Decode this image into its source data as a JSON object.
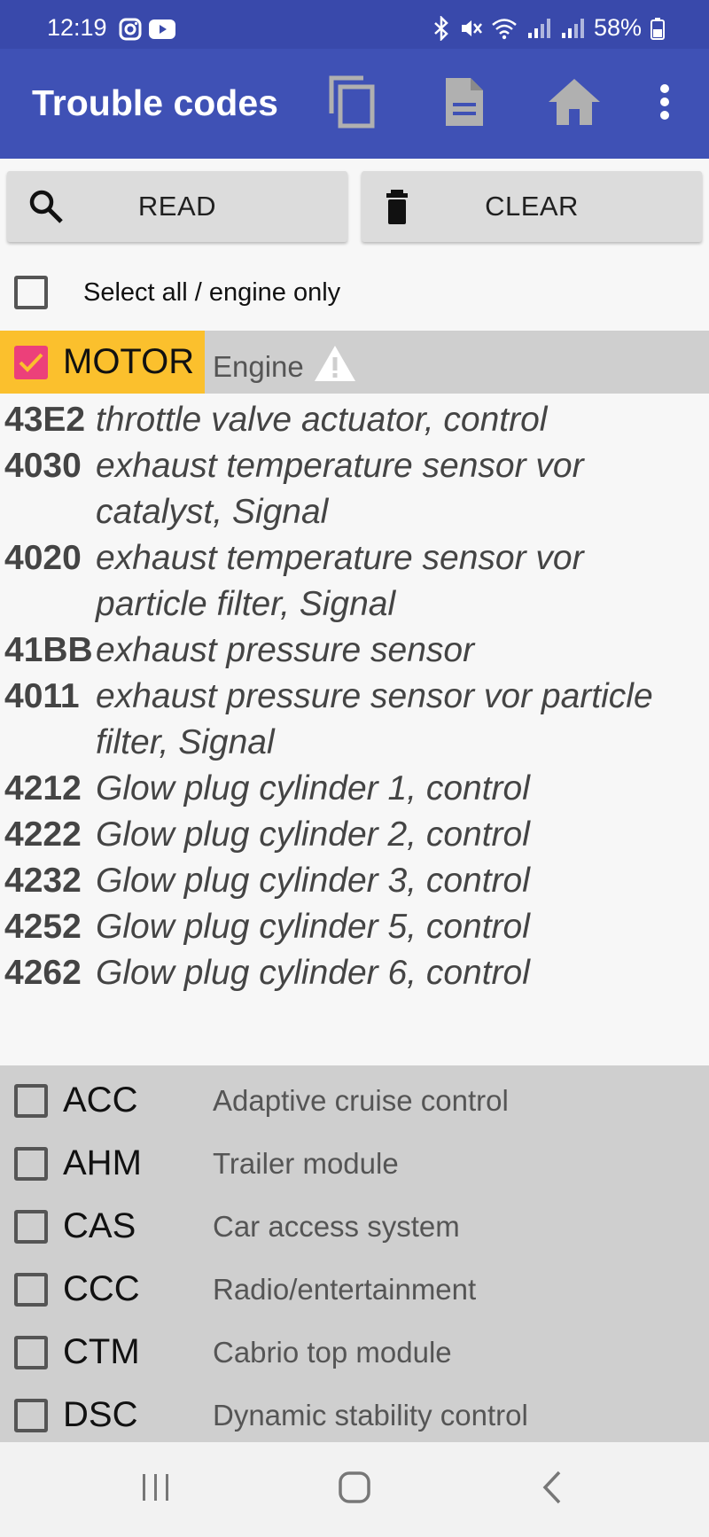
{
  "status": {
    "time": "12:19",
    "battery": "58%"
  },
  "appbar": {
    "title": "Trouble codes",
    "actions": [
      "copy-icon",
      "document-icon",
      "home-icon",
      "more-vert-icon"
    ]
  },
  "toolbar": {
    "read_label": "READ",
    "clear_label": "CLEAR"
  },
  "select_all": {
    "label": "Select all / engine only",
    "checked": false
  },
  "group": {
    "code": "MOTOR",
    "desc": "Engine",
    "checked": true
  },
  "codes": [
    {
      "id": "43E2",
      "text": "throttle valve actuator, control"
    },
    {
      "id": "4030",
      "text": "exhaust temperature sensor vor catalyst, Signal"
    },
    {
      "id": "4020",
      "text": "exhaust temperature sensor vor particle filter, Signal"
    },
    {
      "id": "41BB",
      "text": "exhaust pressure sensor"
    },
    {
      "id": "4011",
      "text": "exhaust pressure sensor vor particle filter, Signal"
    },
    {
      "id": "4212",
      "text": "Glow plug cylinder 1, control"
    },
    {
      "id": "4222",
      "text": "Glow plug cylinder 2, control"
    },
    {
      "id": "4232",
      "text": "Glow plug cylinder 3, control"
    },
    {
      "id": "4252",
      "text": "Glow plug cylinder 5, control"
    },
    {
      "id": "4262",
      "text": "Glow plug cylinder 6, control"
    }
  ],
  "modules": [
    {
      "code": "ACC",
      "desc": "Adaptive cruise control",
      "checked": false
    },
    {
      "code": "AHM",
      "desc": "Trailer module",
      "checked": false
    },
    {
      "code": "CAS",
      "desc": "Car access system",
      "checked": false
    },
    {
      "code": "CCC",
      "desc": "Radio/entertainment",
      "checked": false
    },
    {
      "code": "CTM",
      "desc": "Cabrio top module",
      "checked": false
    },
    {
      "code": "DSC",
      "desc": "Dynamic stability control",
      "checked": false
    }
  ],
  "colors": {
    "status_bar": "#3949ab",
    "app_bar": "#3f51b5",
    "group_highlight": "#fbc02d",
    "checkbox_checked": "#ec407a"
  }
}
